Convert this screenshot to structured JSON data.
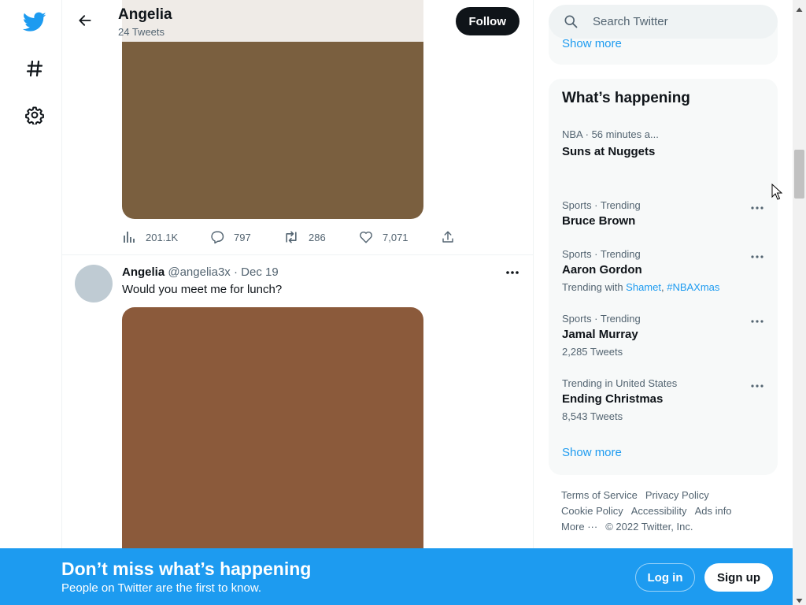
{
  "colors": {
    "brand": "#1d9bf0",
    "text": "#0f1419",
    "muted": "#536471",
    "banner": "#1d9bf0"
  },
  "nav": {
    "icons": [
      "twitter-logo-icon",
      "hashtag-icon",
      "gear-icon"
    ]
  },
  "header": {
    "name": "Angelia",
    "tweet_count": "24 Tweets",
    "follow_label": "Follow"
  },
  "tweet1": {
    "views": "201.1K",
    "replies": "797",
    "retweets": "286",
    "likes": "7,071"
  },
  "tweet2": {
    "name": "Angelia",
    "handle": "@angelia3x",
    "separator": "·",
    "date": "Dec 19",
    "text": "Would you meet me for lunch?"
  },
  "search": {
    "placeholder": "Search Twitter"
  },
  "top_card": {
    "show_more": "Show more"
  },
  "trends": {
    "title": "What’s happening",
    "items": [
      {
        "category": "NBA · 56 minutes a...",
        "name": "Suns at Nuggets"
      },
      {
        "category": "Sports · Trending",
        "name": "Bruce Brown"
      },
      {
        "category": "Sports · Trending",
        "name": "Aaron Gordon",
        "sub_prefix": "Trending with ",
        "link1": "Shamet",
        "link_sep": ", ",
        "link2": "#NBAXmas"
      },
      {
        "category": "Sports · Trending",
        "name": "Jamal Murray",
        "sub": "2,285 Tweets"
      },
      {
        "category": "Trending in United States",
        "name": "Ending Christmas",
        "sub": "8,543 Tweets"
      }
    ],
    "show_more": "Show more"
  },
  "footer": {
    "terms": "Terms of Service",
    "privacy": "Privacy Policy",
    "cookie": "Cookie Policy",
    "accessibility": "Accessibility",
    "ads": "Ads info",
    "more": "More ···",
    "copyright": "© 2022 Twitter, Inc."
  },
  "banner": {
    "title": "Don’t miss what’s happening",
    "subtitle": "People on Twitter are the first to know.",
    "login": "Log in",
    "signup": "Sign up"
  }
}
